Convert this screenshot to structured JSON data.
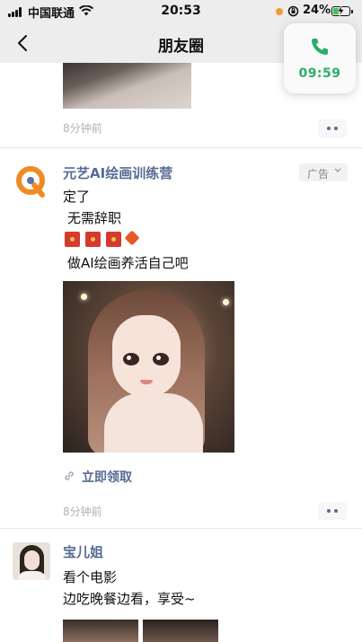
{
  "status_bar": {
    "carrier": "中国联通",
    "time": "20:53",
    "battery_percent": "24%",
    "battery_level": 0.24
  },
  "nav": {
    "title": "朋友圈",
    "back_icon": "chevron-left-icon"
  },
  "call_widget": {
    "icon": "phone-icon",
    "elapsed": "09:59",
    "color": "#2aae67"
  },
  "feed": {
    "previous_post": {
      "time": "8分钟前"
    },
    "ad_post": {
      "author": "元艺AI绘画训练营",
      "ad_label": "广告",
      "lines": [
        "定了",
        "无需辞职",
        "做AI绘画养活自己吧"
      ],
      "emoji": [
        "red-envelope",
        "red-envelope",
        "red-envelope",
        "orange-diamond"
      ],
      "image_alt": "ai-portrait-girl",
      "link_label": "立即领取",
      "time": "8分钟前"
    },
    "user_post": {
      "author": "宝儿姐",
      "lines": [
        "看个电影",
        "边吃晚餐边看，享受~"
      ]
    }
  },
  "colors": {
    "link": "#576b95",
    "chrome": "#ededed",
    "redpack": "#d53a2e",
    "ad_logo": "#f08a24"
  }
}
